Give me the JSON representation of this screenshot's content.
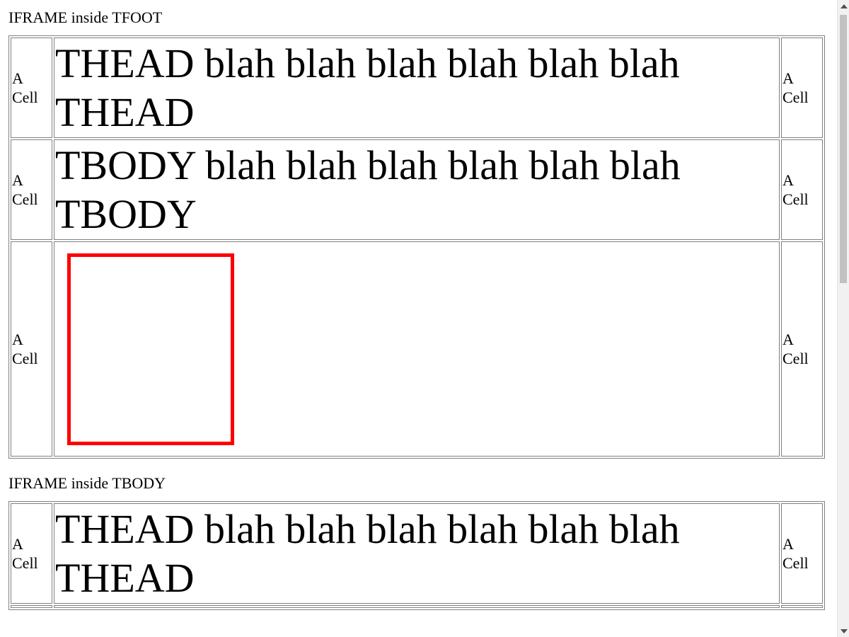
{
  "sections": [
    {
      "label": "IFRAME inside TFOOT",
      "rows": [
        {
          "left": "A Cell",
          "center": "THEAD blah blah blah blah blah blah THEAD",
          "right": "A Cell"
        },
        {
          "left": "A Cell",
          "center": "TBODY blah blah blah blah blah blah TBODY",
          "right": "A Cell"
        },
        {
          "left": "A Cell",
          "center": "",
          "right": "A Cell"
        }
      ]
    },
    {
      "label": "IFRAME inside TBODY",
      "rows": [
        {
          "left": "A Cell",
          "center": "THEAD blah blah blah blah blah blah THEAD",
          "right": "A Cell"
        }
      ]
    }
  ],
  "colors": {
    "iframe_border": "#ff0000",
    "table_border": "#808080",
    "scrollbar_track": "#f1f1f1",
    "scrollbar_thumb": "#c1c1c1"
  },
  "icons": {
    "scroll_up": "scroll-up-arrow-icon",
    "scroll_down": "scroll-down-arrow-icon"
  }
}
